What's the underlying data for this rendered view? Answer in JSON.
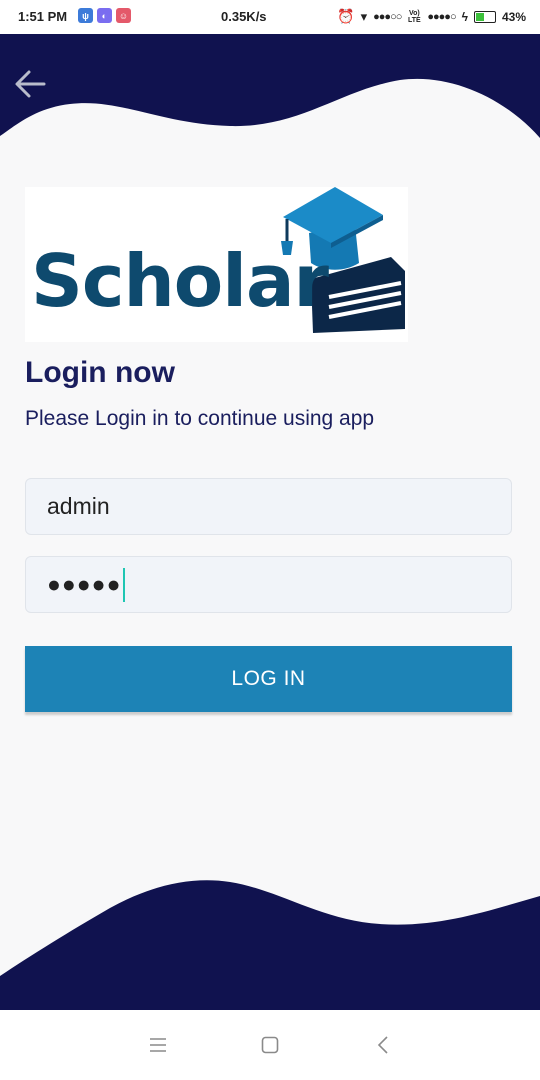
{
  "status_bar": {
    "time": "1:51 PM",
    "network_speed": "0.35K/s",
    "volte_label": "Vo) LTE",
    "battery_percent": "43%",
    "battery_level": 0.43
  },
  "login": {
    "title": "Login now",
    "subtitle": "Please Login in to continue using app",
    "username_value": "admin",
    "password_mask": "●●●●●",
    "button_label": "LOG IN"
  },
  "logo": {
    "text": "Scholar"
  },
  "colors": {
    "navy": "#10124f",
    "button": "#1d83b6",
    "title_text": "#1a1e5e",
    "background": "#f8f8f9"
  },
  "icons": {
    "back": "arrow-left",
    "menu": "hamburger",
    "home": "square",
    "nav_back": "chevron-left"
  }
}
